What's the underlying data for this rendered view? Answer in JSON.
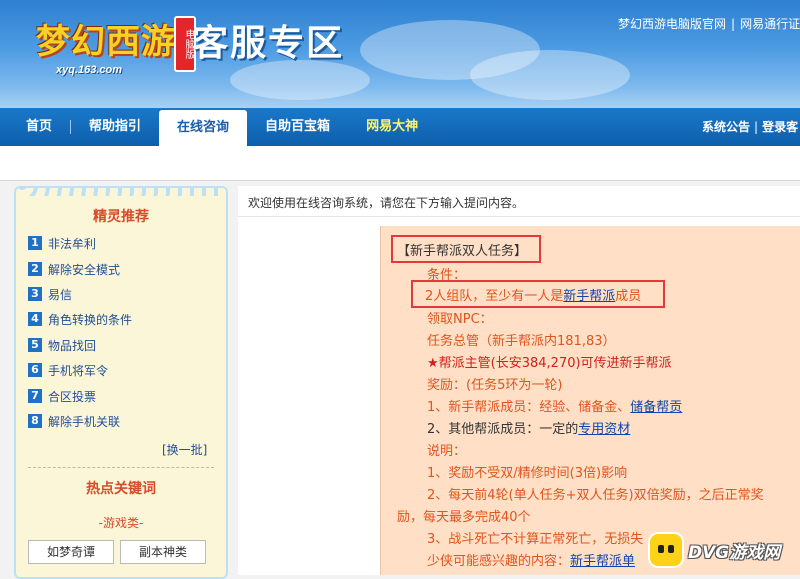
{
  "header": {
    "logo_text": "梦幻西游",
    "logo_badge": "电脑版",
    "logo_url": "xyq.163.com",
    "title": "客服专区",
    "top_links": [
      "梦幻西游电脑版官网",
      "网易通行证"
    ]
  },
  "nav": {
    "items": [
      "首页",
      "帮助指引",
      "在线咨询",
      "自助百宝箱",
      "网易大神"
    ],
    "active": "在线咨询",
    "right_links": [
      "系统公告",
      "登录客"
    ]
  },
  "sidebar": {
    "title": "精灵推荐",
    "items": [
      {
        "num": "1",
        "label": "非法牟利"
      },
      {
        "num": "2",
        "label": "解除安全模式"
      },
      {
        "num": "3",
        "label": "易信"
      },
      {
        "num": "4",
        "label": "角色转换的条件"
      },
      {
        "num": "5",
        "label": "物品找回"
      },
      {
        "num": "6",
        "label": "手机将军令"
      },
      {
        "num": "7",
        "label": "合区投票"
      },
      {
        "num": "8",
        "label": "解除手机关联"
      }
    ],
    "more": "[换一批]",
    "hot_title": "热点关键词",
    "category": "-游戏类-",
    "keywords": [
      "如梦奇谭",
      "副本神类"
    ]
  },
  "main": {
    "welcome": "欢迎使用在线咨询系统，请您在下方输入提问内容。",
    "lines": {
      "l1": "【新手帮派双人任务】",
      "l2": "条件：",
      "l3_pre": "2人组队，至少有一人是",
      "l3_link": "新手帮派",
      "l3_post": "成员",
      "l4": "领取NPC：",
      "l5": "任务总管（新手帮派内181,83）",
      "l6": "★帮派主管(长安384,270)可传进新手帮派",
      "l7": "奖励：(任务5环为一轮)",
      "l8_pre": "1、新手帮派成员：经验、储备金、",
      "l8_link": "储备帮贡",
      "l9_pre": "2、其他帮派成员：一定的",
      "l9_link": "专用资材",
      "l10": "说明：",
      "l11": "1、奖励不受双/精修时间(3倍)影响",
      "l12": "2、每天前4轮(单人任务+双人任务)双倍奖励，之后正常奖",
      "l13": "励，每天最多完成40个",
      "l14": "3、战斗死亡不计算正常死亡，无损失",
      "l15_pre": "少侠可能感兴趣的内容：",
      "l15_link": "新手帮派单"
    }
  },
  "watermark": {
    "text": "DVG游戏网"
  }
}
